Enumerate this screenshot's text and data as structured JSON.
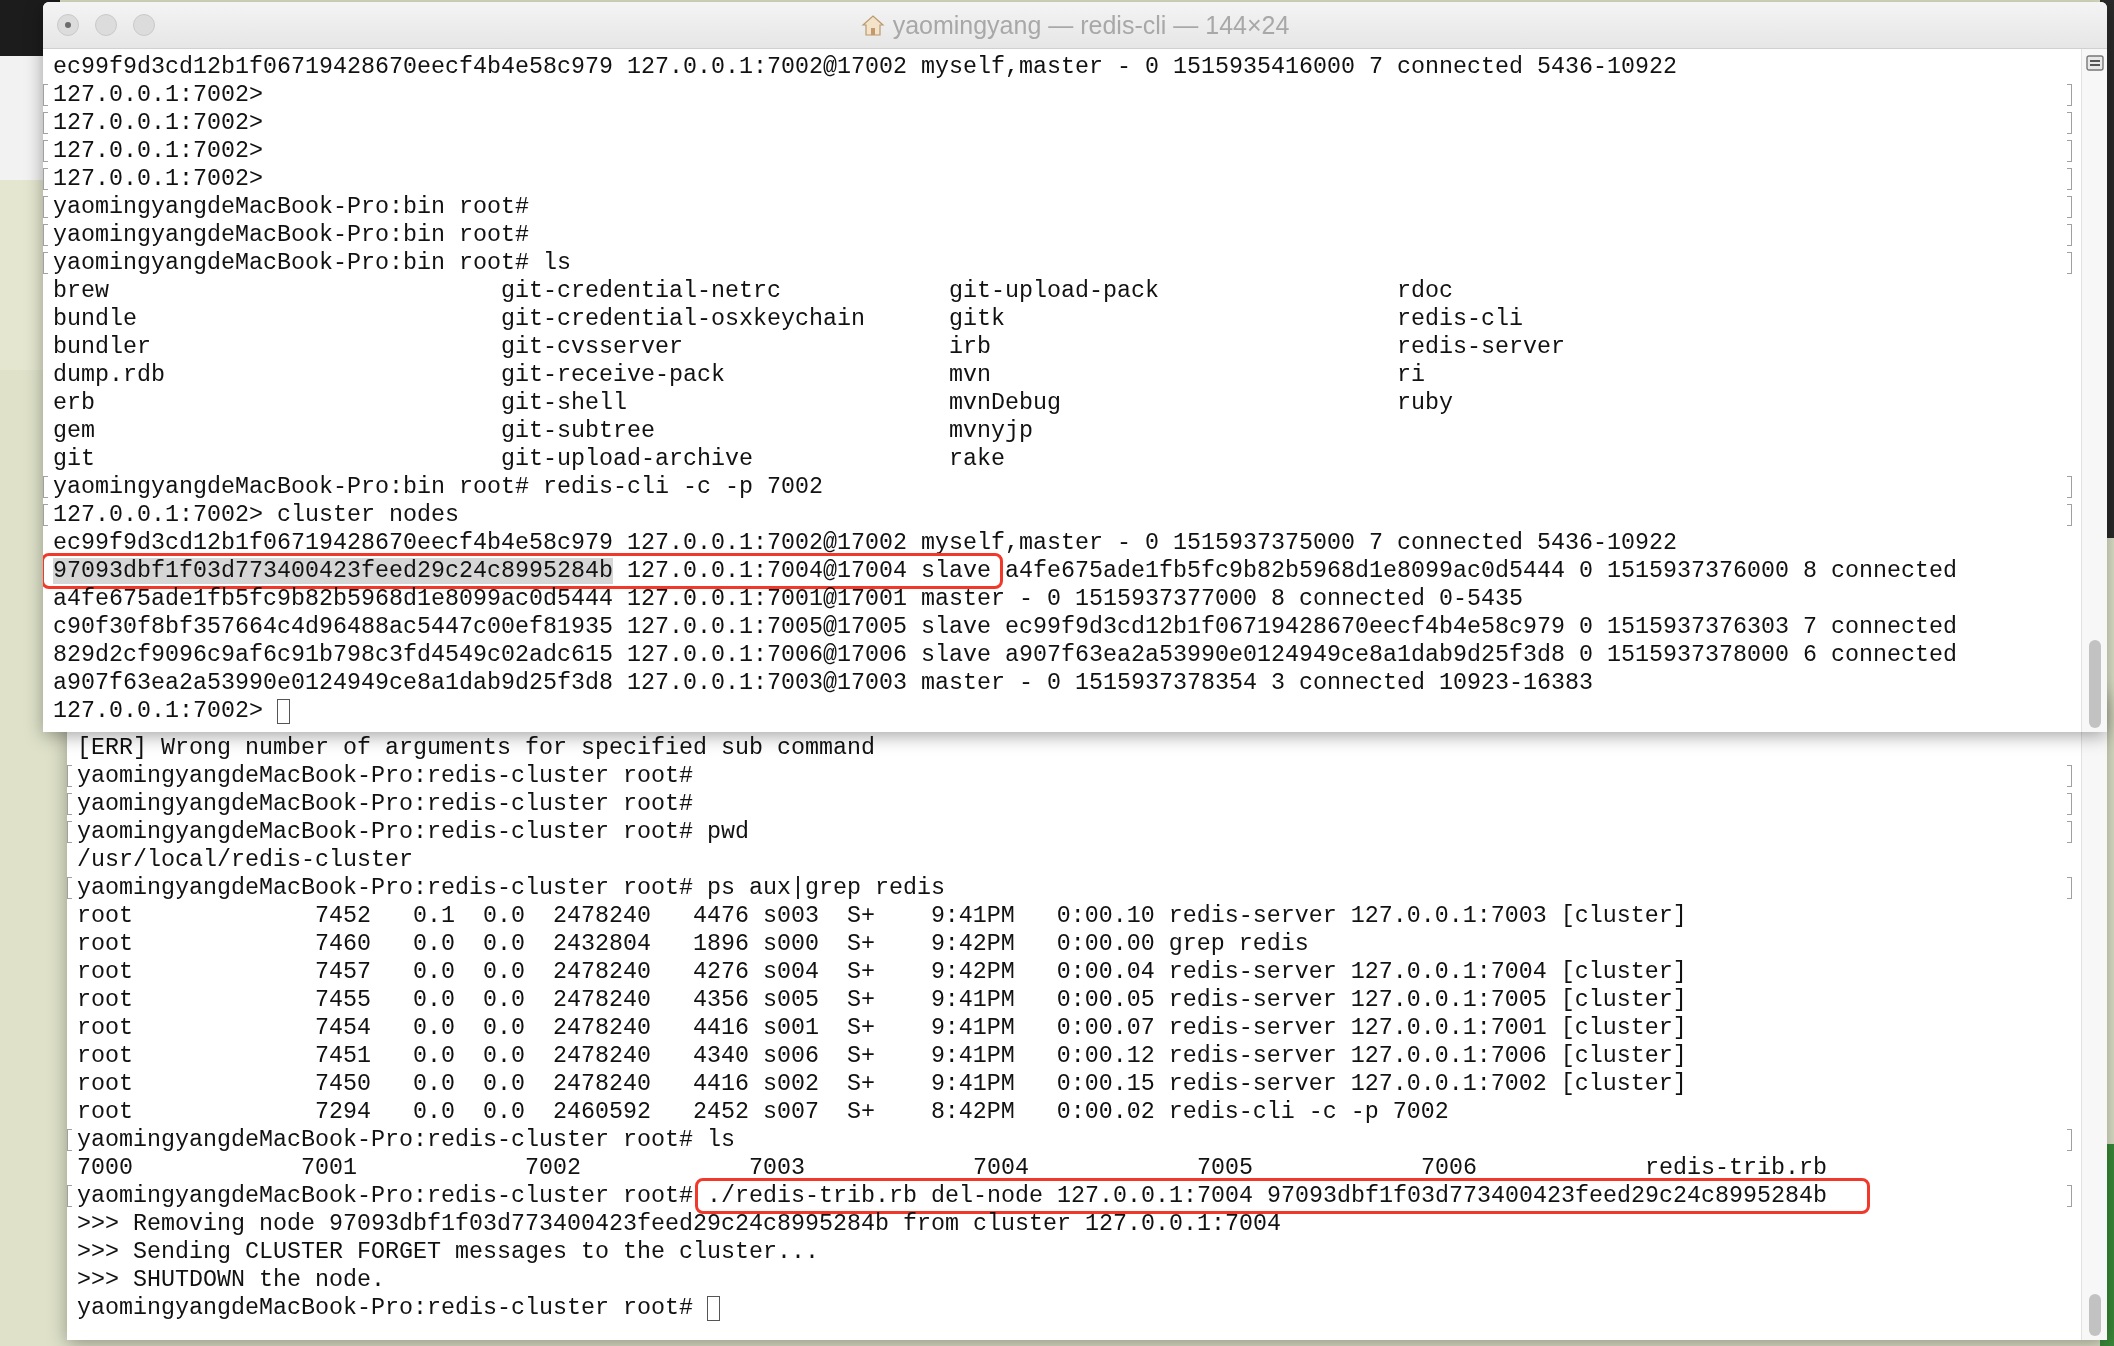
{
  "front_window": {
    "title": "yaomingyang — redis-cli — 144×24",
    "lines": [
      {
        "kind": "text",
        "marked": false,
        "text": "ec99f9d3cd12b1f06719428670eecf4b4e58c979 127.0.0.1:7002@17002 myself,master - 0 1515935416000 7 connected 5436-10922"
      },
      {
        "kind": "text",
        "marked": true,
        "text": "127.0.0.1:7002>"
      },
      {
        "kind": "text",
        "marked": true,
        "text": "127.0.0.1:7002>"
      },
      {
        "kind": "text",
        "marked": true,
        "text": "127.0.0.1:7002>"
      },
      {
        "kind": "text",
        "marked": true,
        "text": "127.0.0.1:7002>"
      },
      {
        "kind": "text",
        "marked": true,
        "text": "yaomingyangdeMacBook-Pro:bin root#"
      },
      {
        "kind": "text",
        "marked": true,
        "text": "yaomingyangdeMacBook-Pro:bin root#"
      },
      {
        "kind": "text",
        "marked": true,
        "text": "yaomingyangdeMacBook-Pro:bin root# ls"
      },
      {
        "kind": "columns",
        "marked": false,
        "cells": [
          "brew",
          "git-credential-netrc",
          "git-upload-pack",
          "rdoc"
        ]
      },
      {
        "kind": "columns",
        "marked": false,
        "cells": [
          "bundle",
          "git-credential-osxkeychain",
          "gitk",
          "redis-cli"
        ]
      },
      {
        "kind": "columns",
        "marked": false,
        "cells": [
          "bundler",
          "git-cvsserver",
          "irb",
          "redis-server"
        ]
      },
      {
        "kind": "columns",
        "marked": false,
        "cells": [
          "dump.rdb",
          "git-receive-pack",
          "mvn",
          "ri"
        ]
      },
      {
        "kind": "columns",
        "marked": false,
        "cells": [
          "erb",
          "git-shell",
          "mvnDebug",
          "ruby"
        ]
      },
      {
        "kind": "columns",
        "marked": false,
        "cells": [
          "gem",
          "git-subtree",
          "mvnyjp"
        ]
      },
      {
        "kind": "columns",
        "marked": false,
        "cells": [
          "git",
          "git-upload-archive",
          "rake"
        ]
      },
      {
        "kind": "text",
        "marked": true,
        "text": "yaomingyangdeMacBook-Pro:bin root# redis-cli -c -p 7002"
      },
      {
        "kind": "text",
        "marked": true,
        "text": "127.0.0.1:7002> cluster nodes"
      },
      {
        "kind": "text",
        "marked": false,
        "text": "ec99f9d3cd12b1f06719428670eecf4b4e58c979 127.0.0.1:7002@17002 myself,master - 0 1515937375000 7 connected 5436-10922"
      },
      {
        "kind": "segments",
        "marked": false,
        "segments": [
          {
            "kind": "annotated",
            "parts": [
              {
                "text": "97093dbf1f03d773400423feed29c24c8995284b",
                "selected": true
              },
              {
                "text": "127.0.0.1:7004@17004 slave",
                "selected": false
              }
            ]
          },
          {
            "kind": "plain",
            "text": "a4fe675ade1fb5fc9b82b5968d1e8099ac0d5444 0 1515937376000 8 connected"
          }
        ]
      },
      {
        "kind": "text",
        "marked": false,
        "text": "a4fe675ade1fb5fc9b82b5968d1e8099ac0d5444 127.0.0.1:7001@17001 master - 0 1515937377000 8 connected 0-5435"
      },
      {
        "kind": "text",
        "marked": false,
        "text": "c90f30f8bf357664c4d96488ac5447c00ef81935 127.0.0.1:7005@17005 slave ec99f9d3cd12b1f06719428670eecf4b4e58c979 0 1515937376303 7 connected"
      },
      {
        "kind": "text",
        "marked": false,
        "text": "829d2cf9096c9af6c91b798c3fd4549c02adc615 127.0.0.1:7006@17006 slave a907f63ea2a53990e0124949ce8a1dab9d25f3d8 0 1515937378000 6 connected"
      },
      {
        "kind": "text",
        "marked": false,
        "text": "a907f63ea2a53990e0124949ce8a1dab9d25f3d8 127.0.0.1:7003@17003 master - 0 1515937378354 3 connected 10923-16383"
      },
      {
        "kind": "prompt",
        "marked": false,
        "text": "127.0.0.1:7002>"
      }
    ]
  },
  "back_window": {
    "lines": [
      {
        "kind": "text",
        "marked": false,
        "text": "[ERR] Wrong number of arguments for specified sub command"
      },
      {
        "kind": "text",
        "marked": true,
        "text": "yaomingyangdeMacBook-Pro:redis-cluster root#"
      },
      {
        "kind": "text",
        "marked": true,
        "text": "yaomingyangdeMacBook-Pro:redis-cluster root#"
      },
      {
        "kind": "text",
        "marked": true,
        "text": "yaomingyangdeMacBook-Pro:redis-cluster root# pwd"
      },
      {
        "kind": "text",
        "marked": false,
        "text": "/usr/local/redis-cluster"
      },
      {
        "kind": "text",
        "marked": true,
        "text": "yaomingyangdeMacBook-Pro:redis-cluster root# ps aux|grep redis"
      },
      {
        "kind": "process",
        "marked": false,
        "cells": [
          "root",
          "7452",
          "0.1",
          "0.0",
          "2478240",
          "4476",
          "s003",
          "S+",
          "9:41PM",
          "0:00.10",
          "redis-server 127.0.0.1:7003 [cluster]"
        ]
      },
      {
        "kind": "process",
        "marked": false,
        "cells": [
          "root",
          "7460",
          "0.0",
          "0.0",
          "2432804",
          "1896",
          "s000",
          "S+",
          "9:42PM",
          "0:00.00",
          "grep redis"
        ]
      },
      {
        "kind": "process",
        "marked": false,
        "cells": [
          "root",
          "7457",
          "0.0",
          "0.0",
          "2478240",
          "4276",
          "s004",
          "S+",
          "9:42PM",
          "0:00.04",
          "redis-server 127.0.0.1:7004 [cluster]"
        ]
      },
      {
        "kind": "process",
        "marked": false,
        "cells": [
          "root",
          "7455",
          "0.0",
          "0.0",
          "2478240",
          "4356",
          "s005",
          "S+",
          "9:41PM",
          "0:00.05",
          "redis-server 127.0.0.1:7005 [cluster]"
        ]
      },
      {
        "kind": "process",
        "marked": false,
        "cells": [
          "root",
          "7454",
          "0.0",
          "0.0",
          "2478240",
          "4416",
          "s001",
          "S+",
          "9:41PM",
          "0:00.07",
          "redis-server 127.0.0.1:7001 [cluster]"
        ]
      },
      {
        "kind": "process",
        "marked": false,
        "cells": [
          "root",
          "7451",
          "0.0",
          "0.0",
          "2478240",
          "4340",
          "s006",
          "S+",
          "9:41PM",
          "0:00.12",
          "redis-server 127.0.0.1:7006 [cluster]"
        ]
      },
      {
        "kind": "process",
        "marked": false,
        "cells": [
          "root",
          "7450",
          "0.0",
          "0.0",
          "2478240",
          "4416",
          "s002",
          "S+",
          "9:41PM",
          "0:00.15",
          "redis-server 127.0.0.1:7002 [cluster]"
        ]
      },
      {
        "kind": "process",
        "marked": false,
        "cells": [
          "root",
          "7294",
          "0.0",
          "0.0",
          "2460592",
          "2452",
          "s007",
          "S+",
          "8:42PM",
          "0:00.02",
          "redis-cli -c -p 7002"
        ]
      },
      {
        "kind": "text",
        "marked": true,
        "text": "yaomingyangdeMacBook-Pro:redis-cluster root# ls"
      },
      {
        "kind": "columns",
        "marked": false,
        "cells": [
          "7000",
          "7001",
          "7002",
          "7003",
          "7004",
          "7005",
          "7006",
          "redis-trib.rb"
        ]
      },
      {
        "kind": "segments",
        "marked": true,
        "segments": [
          {
            "kind": "plain",
            "text": "yaomingyangdeMacBook-Pro:redis-cluster root#"
          },
          {
            "kind": "annotated",
            "parts": [
              {
                "text": "./redis-trib.rb del-node 127.0.0.1:7004 97093dbf1f03d773400423feed29c24c8995284b",
                "selected": false
              }
            ]
          }
        ]
      },
      {
        "kind": "text",
        "marked": false,
        "text": ">>> Removing node 97093dbf1f03d773400423feed29c24c8995284b from cluster 127.0.0.1:7004"
      },
      {
        "kind": "text",
        "marked": false,
        "text": ">>> Sending CLUSTER FORGET messages to the cluster..."
      },
      {
        "kind": "text",
        "marked": false,
        "text": ">>> SHUTDOWN the node."
      },
      {
        "kind": "prompt",
        "marked": false,
        "text": "yaomingyangdeMacBook-Pro:redis-cluster root#"
      }
    ]
  }
}
